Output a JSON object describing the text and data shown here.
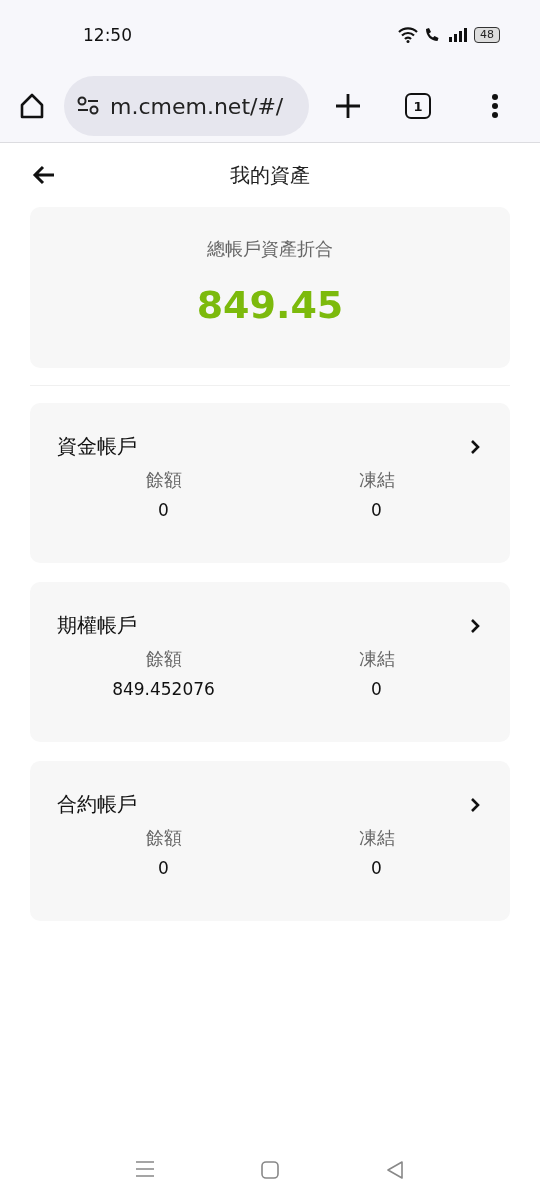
{
  "status_bar": {
    "time": "12:50",
    "battery": "48"
  },
  "browser": {
    "url": "m.cmem.net/#/",
    "tab_count": "1"
  },
  "header": {
    "title": "我的資產"
  },
  "summary": {
    "label": "總帳戶資產折合",
    "value": "849.45"
  },
  "accounts": [
    {
      "name": "資金帳戶",
      "balance_label": "餘額",
      "balance": "0",
      "frozen_label": "凍結",
      "frozen": "0"
    },
    {
      "name": "期權帳戶",
      "balance_label": "餘額",
      "balance": "849.452076",
      "frozen_label": "凍結",
      "frozen": "0"
    },
    {
      "name": "合約帳戶",
      "balance_label": "餘額",
      "balance": "0",
      "frozen_label": "凍結",
      "frozen": "0"
    }
  ]
}
